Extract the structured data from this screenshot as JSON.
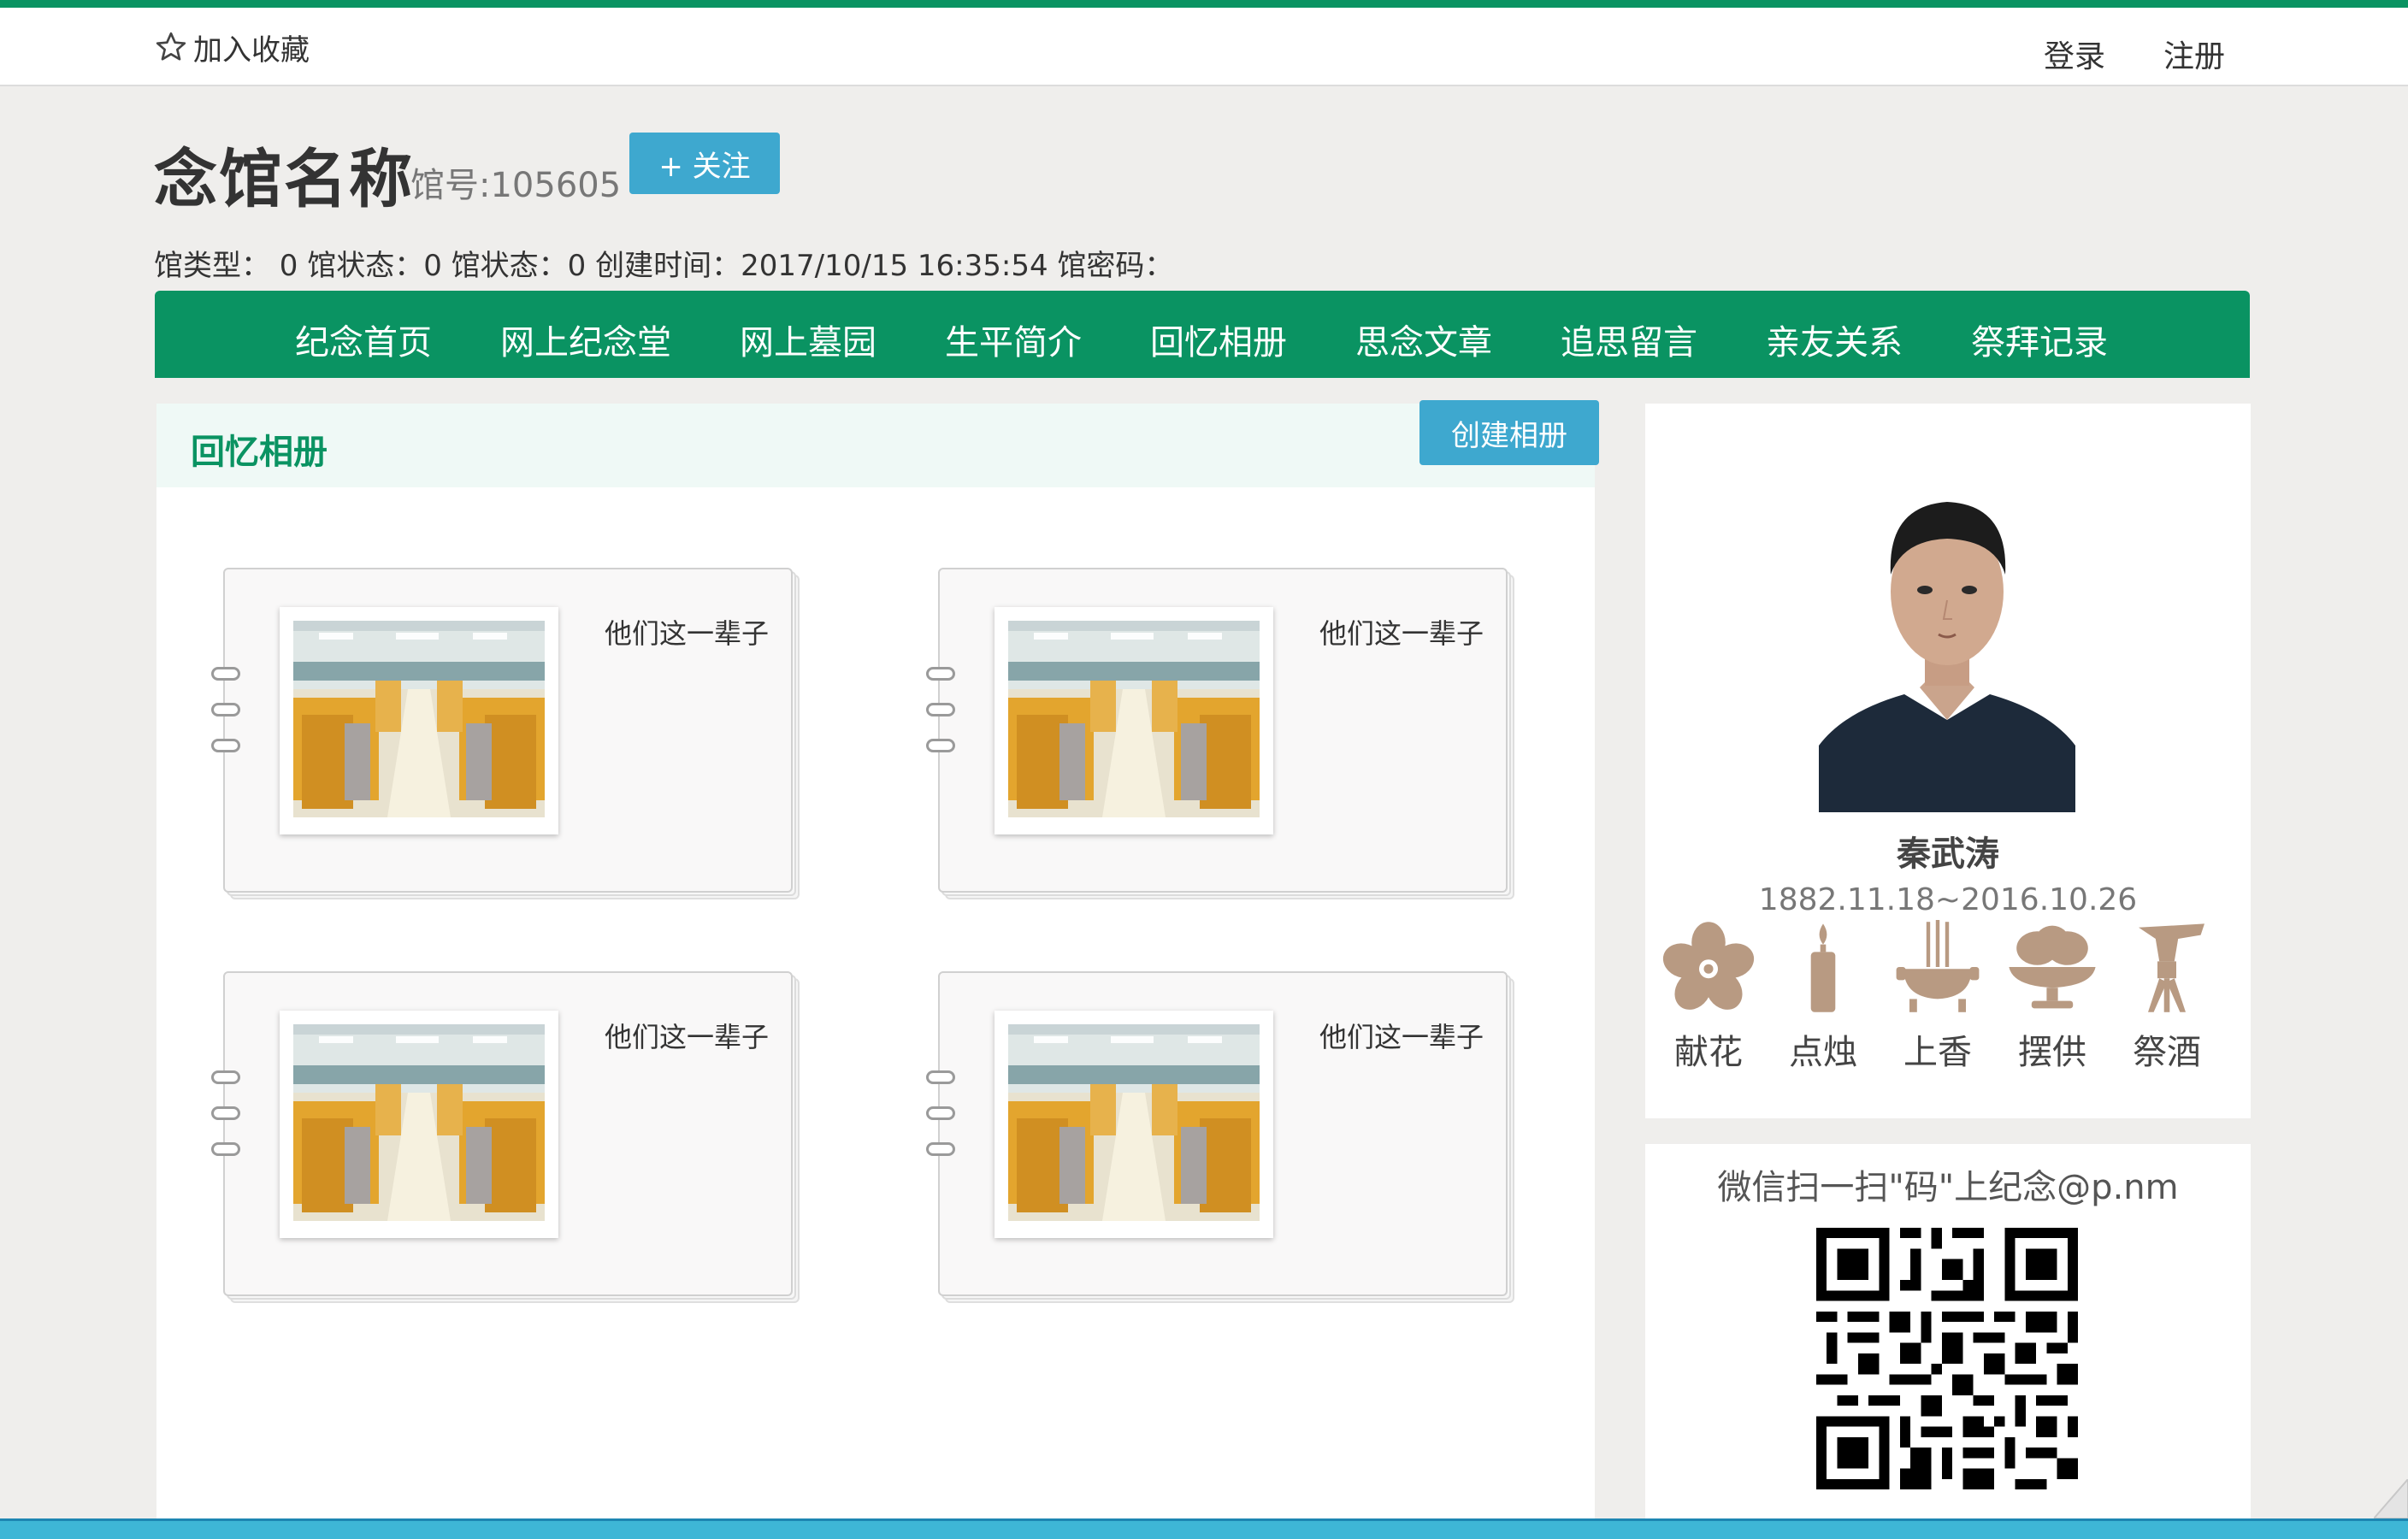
{
  "topbar": {
    "favorite_label": "加入收藏",
    "login_label": "登录",
    "register_label": "注册"
  },
  "hall": {
    "title": "念馆名称",
    "number": "馆号:105605",
    "follow_label": "+ 关注",
    "info": "馆类型： 0 馆状态：0 馆状态：0 创建时间：2017/10/15 16:35:54 馆密码："
  },
  "nav": {
    "items": [
      {
        "label": "纪念首页"
      },
      {
        "label": "网上纪念堂"
      },
      {
        "label": "网上墓园"
      },
      {
        "label": "生平简介"
      },
      {
        "label": "回忆相册"
      },
      {
        "label": "思念文章"
      },
      {
        "label": "追思留言"
      },
      {
        "label": "亲友关系"
      },
      {
        "label": "祭拜记录"
      }
    ]
  },
  "albums": {
    "title": "回忆相册",
    "create_label": "创建相册",
    "items": [
      {
        "name": "他们这一辈子"
      },
      {
        "name": "他们这一辈子"
      },
      {
        "name": "他们这一辈子"
      },
      {
        "name": "他们这一辈子"
      }
    ]
  },
  "person": {
    "name": "秦武涛",
    "dates": "1882.11.18~2016.10.26",
    "offerings": [
      {
        "label": "献花",
        "icon": "flower-icon"
      },
      {
        "label": "点烛",
        "icon": "candle-icon"
      },
      {
        "label": "上香",
        "icon": "incense-icon"
      },
      {
        "label": "摆供",
        "icon": "offering-icon"
      },
      {
        "label": "祭酒",
        "icon": "wine-vessel-icon"
      }
    ]
  },
  "qr": {
    "title": "微信扫一扫\"码\"上纪念@p.nm"
  },
  "colors": {
    "brand_green": "#0a9362",
    "button_blue": "#3ea8cf",
    "offering_brown": "#b89a82"
  }
}
